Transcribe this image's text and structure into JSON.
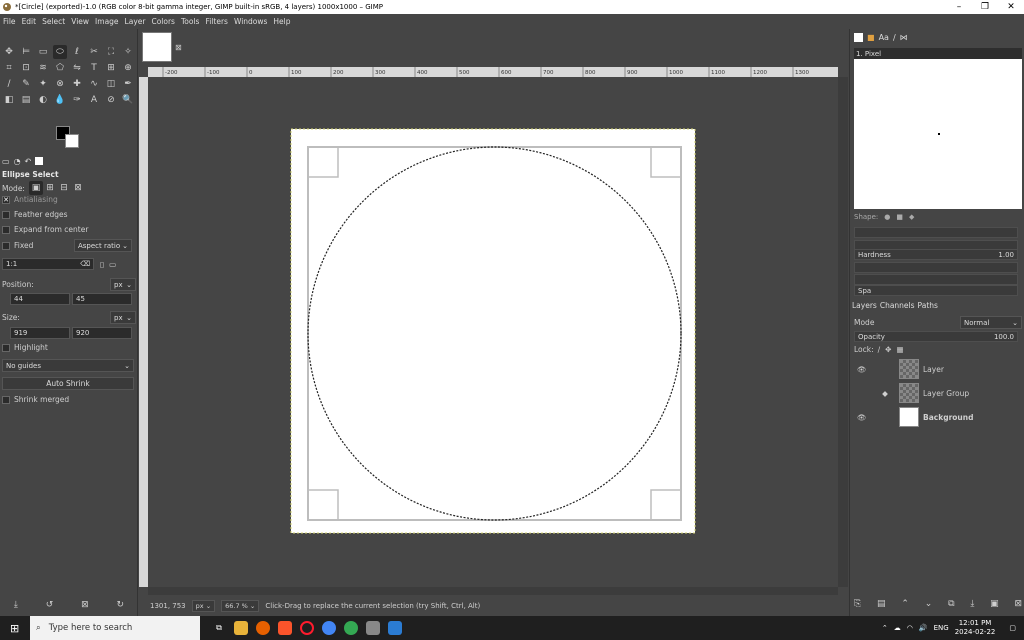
{
  "window": {
    "title": "*[Circle] (exported)-1.0 (RGB color 8-bit gamma integer, GIMP built-in sRGB, 4 layers) 1000x1000 – GIMP",
    "minimize": "–",
    "maximize": "❐",
    "close": "✕"
  },
  "menu": [
    "File",
    "Edit",
    "Select",
    "View",
    "Image",
    "Layer",
    "Colors",
    "Tools",
    "Filters",
    "Windows",
    "Help"
  ],
  "toolbox": {
    "tools": [
      {
        "icon": "move-icon",
        "glyph": "✥"
      },
      {
        "icon": "align-icon",
        "glyph": "⊨"
      },
      {
        "icon": "rect-select-icon",
        "glyph": "▭"
      },
      {
        "icon": "ellipse-select-icon",
        "glyph": "⬭"
      },
      {
        "icon": "free-select-icon",
        "glyph": "ℓ"
      },
      {
        "icon": "scissors-icon",
        "glyph": "✂"
      },
      {
        "icon": "foreground-select-icon",
        "glyph": "⛶"
      },
      {
        "icon": "fuzzy-select-icon",
        "glyph": "✧"
      },
      {
        "icon": "crop-icon",
        "glyph": "⌗"
      },
      {
        "icon": "unified-transform-icon",
        "glyph": "⊡"
      },
      {
        "icon": "warp-icon",
        "glyph": "≋"
      },
      {
        "icon": "cage-icon",
        "glyph": "⬠"
      },
      {
        "icon": "flip-icon",
        "glyph": "⇋"
      },
      {
        "icon": "text-icon",
        "glyph": "T"
      },
      {
        "icon": "perspective-icon",
        "glyph": "⊞"
      },
      {
        "icon": "measure-icon",
        "glyph": "⊕"
      },
      {
        "icon": "paintbrush-icon",
        "glyph": "∕"
      },
      {
        "icon": "pencil-icon",
        "glyph": "✎"
      },
      {
        "icon": "airbrush-icon",
        "glyph": "✦"
      },
      {
        "icon": "clone-icon",
        "glyph": "⊗"
      },
      {
        "icon": "heal-icon",
        "glyph": "✚"
      },
      {
        "icon": "smudge-icon",
        "glyph": "∿"
      },
      {
        "icon": "eraser-icon",
        "glyph": "◫"
      },
      {
        "icon": "ink-icon",
        "glyph": "✒"
      },
      {
        "icon": "bucket-fill-icon",
        "glyph": "◧"
      },
      {
        "icon": "gradient-icon",
        "glyph": "▤"
      },
      {
        "icon": "dodge-icon",
        "glyph": "◐"
      },
      {
        "icon": "blur-icon",
        "glyph": "💧"
      },
      {
        "icon": "path-icon",
        "glyph": "✑"
      },
      {
        "icon": "text-tool-icon",
        "glyph": "A"
      },
      {
        "icon": "color-picker-icon",
        "glyph": "⊘"
      },
      {
        "icon": "zoom-icon",
        "glyph": "🔍"
      }
    ]
  },
  "tool_options": {
    "title": "Ellipse Select",
    "mode_label": "Mode:",
    "antialiasing": "Antialiasing",
    "feather": "Feather edges",
    "expand": "Expand from center",
    "fixed": "Fixed",
    "aspect": "Aspect ratio",
    "ratio": "1:1",
    "position_label": "Position:",
    "pos_x": "44",
    "pos_y": "45",
    "size_label": "Size:",
    "size_w": "919",
    "size_h": "920",
    "unit": "px",
    "highlight": "Highlight",
    "guides": "No guides",
    "auto_shrink": "Auto Shrink",
    "shrink_merged": "Shrink merged"
  },
  "rulers": {
    "h_labels": [
      "-200",
      "-100",
      "0",
      "100",
      "200",
      "300",
      "400",
      "500",
      "600",
      "700",
      "800",
      "900",
      "1000",
      "1100",
      "1200",
      "1300"
    ]
  },
  "status": {
    "coords": "1301, 753",
    "unit": "px",
    "zoom": "66.7 %",
    "message": "Click-Drag to replace the current selection (try Shift, Ctrl, Alt)"
  },
  "brushes": {
    "header": "1. Pixel",
    "shape_label": "Shape:",
    "hardness_label": "Hardness",
    "hardness_value": "1.00",
    "spacing_label": "Spa"
  },
  "layers": {
    "tabs": [
      "Layers",
      "Channels",
      "Paths"
    ],
    "mode_label": "Mode",
    "mode_value": "Normal",
    "opacity_label": "Opacity",
    "opacity_value": "100.0",
    "lock_label": "Lock:",
    "items": [
      {
        "name": "Layer",
        "visible": true
      },
      {
        "name": "Layer Group",
        "visible": false
      },
      {
        "name": "Background",
        "visible": true
      }
    ]
  },
  "taskbar": {
    "search_placeholder": "Type here to search",
    "lang": "ENG",
    "time": "12:01 PM",
    "date": "2024-02-22"
  }
}
